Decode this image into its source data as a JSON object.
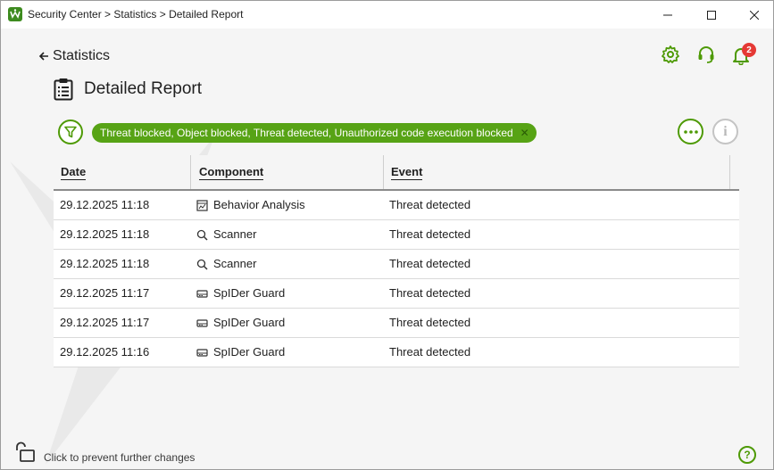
{
  "window": {
    "title": "Security Center > Statistics > Detailed Report",
    "controls": {
      "minimize": "–",
      "maximize": "☐",
      "close": "✕"
    }
  },
  "nav": {
    "back_label": "Statistics"
  },
  "header": {
    "notification_count": "2"
  },
  "page": {
    "title": "Detailed Report"
  },
  "filter": {
    "chip_label": "Threat blocked, Object blocked, Threat detected, Unauthorized code execution blocked",
    "chip_close": "✕"
  },
  "table": {
    "headers": {
      "date": "Date",
      "component": "Component",
      "event": "Event"
    },
    "rows": [
      {
        "date": "29.12.2025 11:18",
        "component": "Behavior Analysis",
        "component_icon": "behavior-analysis-icon",
        "event": "Threat detected"
      },
      {
        "date": "29.12.2025 11:18",
        "component": "Scanner",
        "component_icon": "search-icon",
        "event": "Threat detected"
      },
      {
        "date": "29.12.2025 11:18",
        "component": "Scanner",
        "component_icon": "search-icon",
        "event": "Threat detected"
      },
      {
        "date": "29.12.2025 11:17",
        "component": "SpIDer Guard",
        "component_icon": "drive-icon",
        "event": "Threat detected"
      },
      {
        "date": "29.12.2025 11:17",
        "component": "SpIDer Guard",
        "component_icon": "drive-icon",
        "event": "Threat detected"
      },
      {
        "date": "29.12.2025 11:16",
        "component": "SpIDer Guard",
        "component_icon": "drive-icon",
        "event": "Threat detected"
      }
    ]
  },
  "footer": {
    "lock_text": "Click to prevent further changes",
    "help_label": "?"
  },
  "colors": {
    "accent": "#4e9a06",
    "chip": "#57a315",
    "badge": "#e53935"
  }
}
